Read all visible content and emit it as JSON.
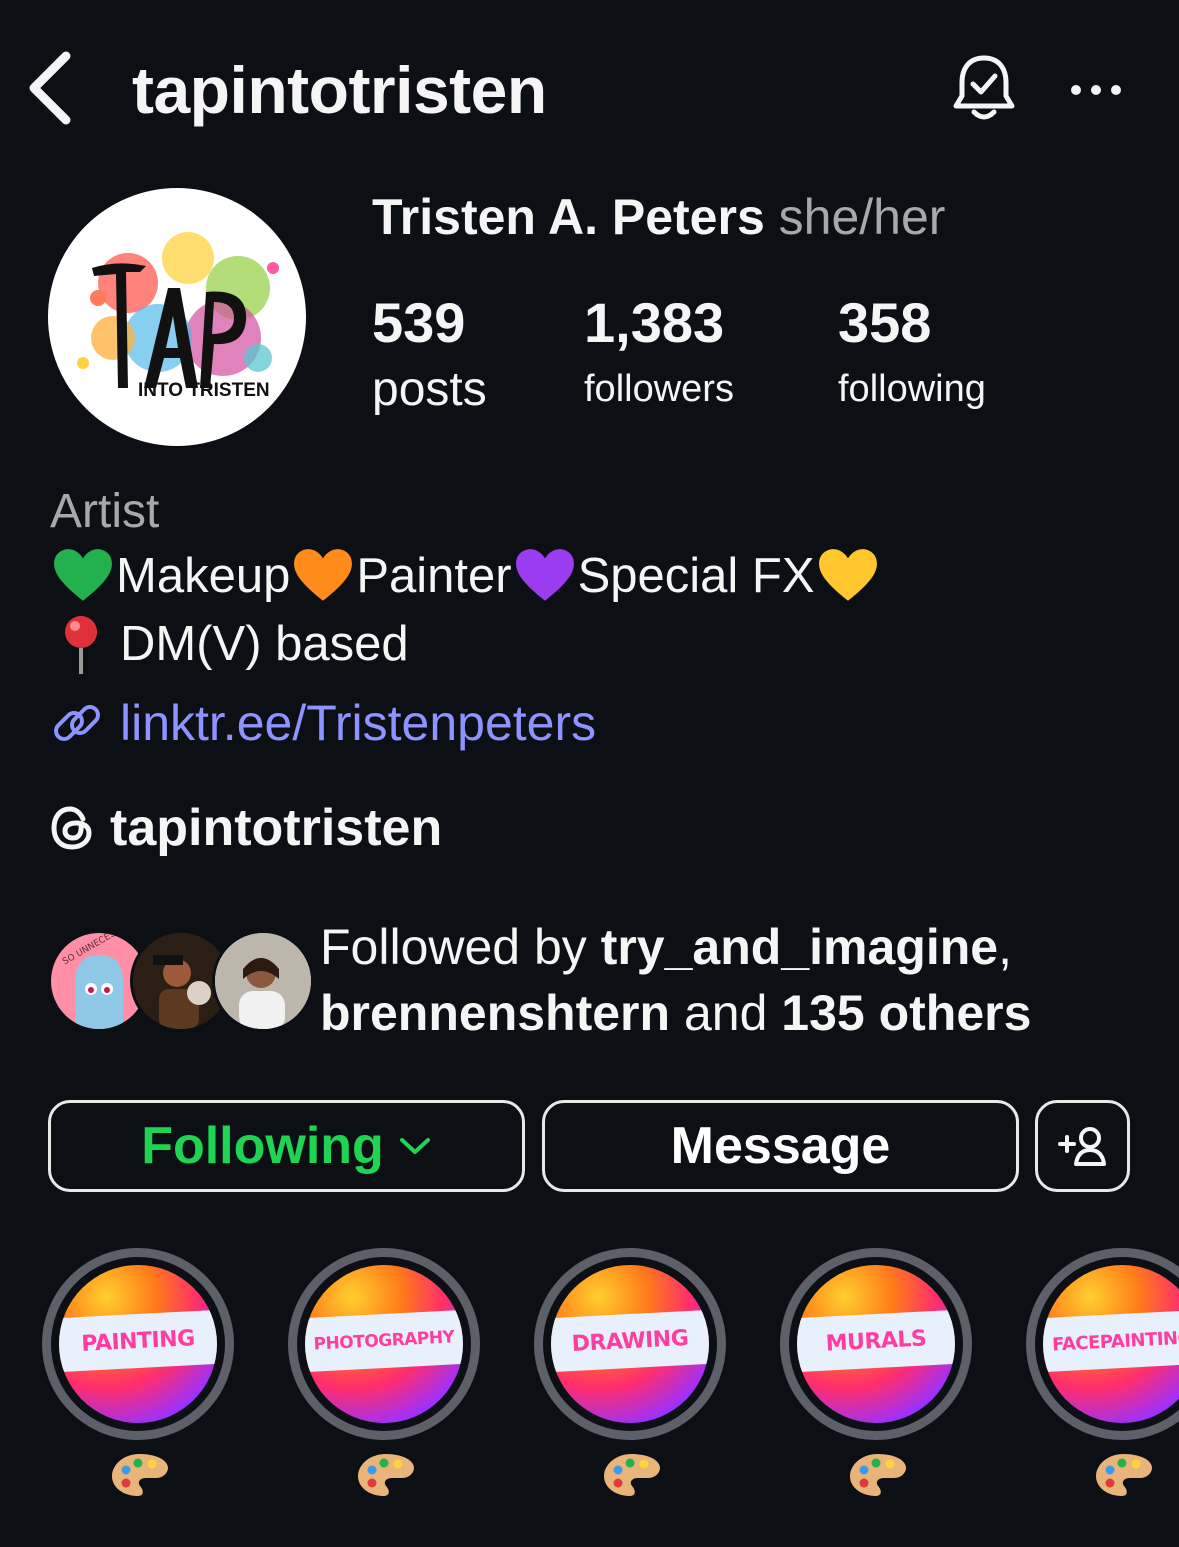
{
  "header": {
    "username": "tapintotristen"
  },
  "profile": {
    "avatar_logo_text": "TAP",
    "avatar_logo_subtext": "INTO TRISTEN",
    "display_name": "Tristen A. Peters",
    "pronouns": "she/her",
    "stats": {
      "posts_count": "539",
      "posts_label": "posts",
      "followers_count": "1,383",
      "followers_label": "followers",
      "following_count": "358",
      "following_label": "following"
    },
    "category": "Artist",
    "bio": {
      "line1": [
        "Makeup",
        "Painter",
        "Special FX"
      ],
      "heart_colors": [
        "#22b14c",
        "#ff8c1a",
        "#9b3cf0",
        "#ffc62e"
      ],
      "line2": "DM(V) based"
    },
    "link": "linktr.ee/Tristenpeters",
    "threads_handle": "tapintotristen"
  },
  "followed_by": {
    "prefix": "Followed by ",
    "user1": "try_and_imagine",
    "sep": ",",
    "user2": "brennenshtern",
    "and": " and ",
    "others": "135 others",
    "avatar1_text": "SO UNNECESSARY"
  },
  "actions": {
    "following_label": "Following",
    "message_label": "Message"
  },
  "highlights": [
    {
      "title": "PAINTING",
      "label_icon": "artist-palette-icon"
    },
    {
      "title": "PHOTOGRAPHY",
      "label_icon": "artist-palette-icon"
    },
    {
      "title": "DRAWING",
      "label_icon": "artist-palette-icon"
    },
    {
      "title": "MURALS",
      "label_icon": "artist-palette-icon"
    },
    {
      "title": "FACEPAINTING",
      "label_icon": "artist-palette-icon"
    }
  ],
  "colors": {
    "background": "#0c0f14",
    "following_green": "#1fd452",
    "link_blue": "#8d93ff",
    "muted": "#a8a8a8"
  }
}
